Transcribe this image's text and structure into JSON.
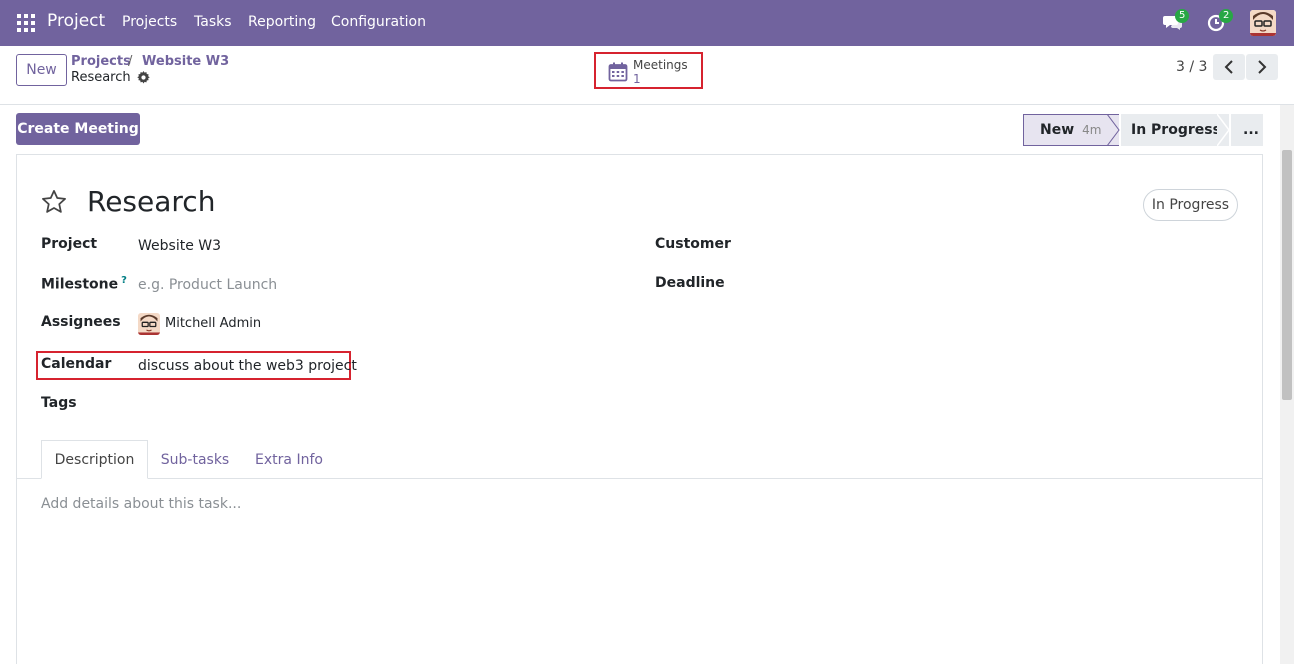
{
  "navbar": {
    "brand": "Project",
    "menu": [
      "Projects",
      "Tasks",
      "Reporting",
      "Configuration"
    ],
    "chat_count": "5",
    "activity_count": "2",
    "color": "#71639e"
  },
  "control": {
    "new_label": "New",
    "breadcrumb": [
      "Projects",
      "Website W3"
    ],
    "breadcrumb_sep": "/",
    "current": "Research",
    "smart_button": {
      "label": "Meetings",
      "value": "1",
      "icon": "calendar-icon"
    },
    "pager": "3 / 3"
  },
  "actions": {
    "create_meeting": "Create Meeting"
  },
  "statusbar": {
    "stages": [
      {
        "label": "New",
        "time": "4m",
        "active": true
      },
      {
        "label": "In Progress",
        "active": false
      },
      {
        "label": "...",
        "active": false
      }
    ]
  },
  "form": {
    "title": "Research",
    "stage_badge": "In Progress",
    "fields": {
      "project": {
        "label": "Project",
        "value": "Website W3"
      },
      "milestone": {
        "label": "Milestone",
        "help": "?",
        "placeholder": "e.g. Product Launch"
      },
      "assignees": {
        "label": "Assignees",
        "value": "Mitchell Admin"
      },
      "calendar": {
        "label": "Calendar",
        "value": "discuss about the web3 project"
      },
      "tags": {
        "label": "Tags"
      },
      "customer": {
        "label": "Customer"
      },
      "deadline": {
        "label": "Deadline"
      }
    },
    "tabs": [
      "Description",
      "Sub-tasks",
      "Extra Info"
    ],
    "description_placeholder": "Add details about this task..."
  },
  "highlight_color": "#d6232f"
}
